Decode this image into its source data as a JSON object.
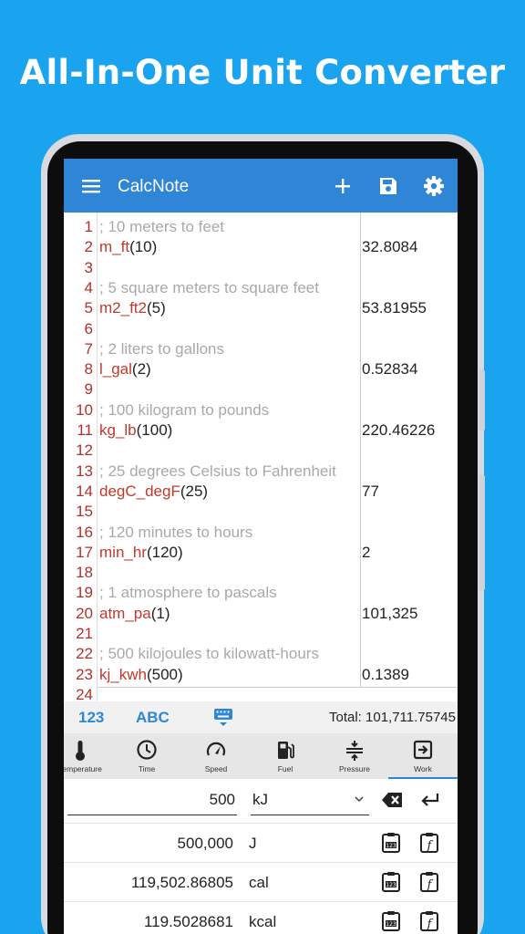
{
  "headline": "All-In-One Unit Converter",
  "appbar": {
    "title": "CalcNote"
  },
  "lines": [
    {
      "n": "1",
      "comment": "; 10 meters to feet",
      "fn": "",
      "args": "",
      "result": ""
    },
    {
      "n": "2",
      "comment": "",
      "fn": "m_ft",
      "args": "(10)",
      "result": "32.8084"
    },
    {
      "n": "3",
      "comment": "",
      "fn": "",
      "args": "",
      "result": ""
    },
    {
      "n": "4",
      "comment": "; 5 square meters to square feet",
      "fn": "",
      "args": "",
      "result": ""
    },
    {
      "n": "5",
      "comment": "",
      "fn": "m2_ft2",
      "args": "(5)",
      "result": "53.81955"
    },
    {
      "n": "6",
      "comment": "",
      "fn": "",
      "args": "",
      "result": ""
    },
    {
      "n": "7",
      "comment": "; 2 liters to gallons",
      "fn": "",
      "args": "",
      "result": ""
    },
    {
      "n": "8",
      "comment": "",
      "fn": "l_gal",
      "args": "(2)",
      "result": "0.52834"
    },
    {
      "n": "9",
      "comment": "",
      "fn": "",
      "args": "",
      "result": ""
    },
    {
      "n": "10",
      "comment": "; 100 kilogram to pounds",
      "fn": "",
      "args": "",
      "result": ""
    },
    {
      "n": "11",
      "comment": "",
      "fn": "kg_lb",
      "args": "(100)",
      "result": "220.46226"
    },
    {
      "n": "12",
      "comment": "",
      "fn": "",
      "args": "",
      "result": ""
    },
    {
      "n": "13",
      "comment": "; 25 degrees Celsius to Fahrenheit",
      "fn": "",
      "args": "",
      "result": ""
    },
    {
      "n": "14",
      "comment": "",
      "fn": "degC_degF",
      "args": "(25)",
      "result": "77"
    },
    {
      "n": "15",
      "comment": "",
      "fn": "",
      "args": "",
      "result": ""
    },
    {
      "n": "16",
      "comment": "; 120 minutes to hours",
      "fn": "",
      "args": "",
      "result": ""
    },
    {
      "n": "17",
      "comment": "",
      "fn": "min_hr",
      "args": "(120)",
      "result": "2"
    },
    {
      "n": "18",
      "comment": "",
      "fn": "",
      "args": "",
      "result": ""
    },
    {
      "n": "19",
      "comment": "; 1 atmosphere to pascals",
      "fn": "",
      "args": "",
      "result": ""
    },
    {
      "n": "20",
      "comment": "",
      "fn": "atm_pa",
      "args": "(1)",
      "result": "101,325"
    },
    {
      "n": "21",
      "comment": "",
      "fn": "",
      "args": "",
      "result": ""
    },
    {
      "n": "22",
      "comment": "; 500 kilojoules to kilowatt-hours",
      "fn": "",
      "args": "",
      "result": ""
    },
    {
      "n": "23",
      "comment": "",
      "fn": "kj_kwh",
      "args": "(500)",
      "result": "0.1389"
    },
    {
      "n": "24",
      "comment": "",
      "fn": "",
      "args": "",
      "result": ""
    }
  ],
  "keybar": {
    "numeric": "123",
    "alpha": "ABC",
    "total": "Total: 101,711.75745"
  },
  "categories": [
    {
      "label": "Temperature",
      "icon": "thermometer-icon"
    },
    {
      "label": "Time",
      "icon": "clock-icon"
    },
    {
      "label": "Speed",
      "icon": "speedometer-icon"
    },
    {
      "label": "Fuel",
      "icon": "fuel-pump-icon"
    },
    {
      "label": "Pressure",
      "icon": "pressure-icon"
    },
    {
      "label": "Work",
      "icon": "work-icon"
    }
  ],
  "converter": {
    "input_value": "500",
    "input_unit": "kJ",
    "outputs": [
      {
        "value": "500,000",
        "unit": "J"
      },
      {
        "value": "119,502.86805",
        "unit": "cal"
      },
      {
        "value": "119.5028681",
        "unit": "kcal"
      }
    ]
  },
  "colors": {
    "background": "#1aa3ef",
    "appbar": "#2f86d6",
    "line_number": "#b3302c",
    "function": "#c0392b",
    "comment": "#a9a9a9"
  }
}
